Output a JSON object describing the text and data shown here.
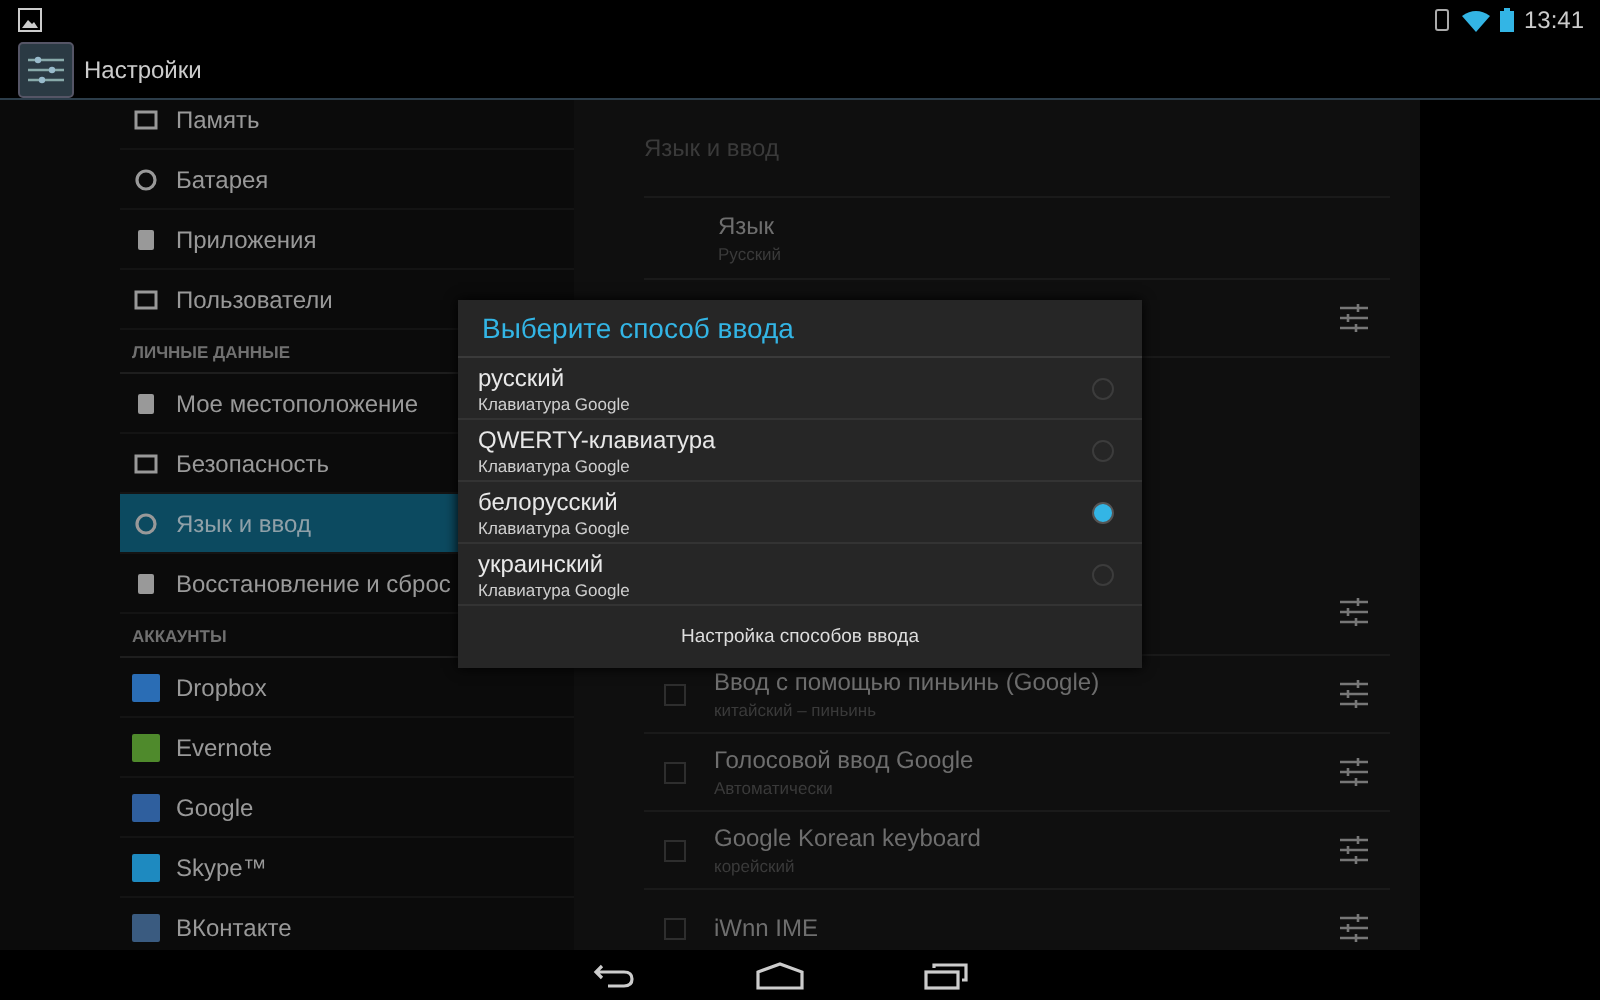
{
  "status_bar": {
    "time": "13:41"
  },
  "action_bar": {
    "title": "Настройки"
  },
  "sidebar": {
    "items": [
      {
        "kind": "item",
        "label": "Память",
        "selected": false
      },
      {
        "kind": "item",
        "label": "Батарея",
        "selected": false
      },
      {
        "kind": "item",
        "label": "Приложения",
        "selected": false
      },
      {
        "kind": "item",
        "label": "Пользователи",
        "selected": false
      },
      {
        "kind": "header",
        "label": "ЛИЧНЫЕ ДАННЫЕ"
      },
      {
        "kind": "item",
        "label": "Мое местоположение",
        "selected": false
      },
      {
        "kind": "item",
        "label": "Безопасность",
        "selected": false
      },
      {
        "kind": "item",
        "label": "Язык и ввод",
        "selected": true
      },
      {
        "kind": "item",
        "label": "Восстановление и сброс",
        "selected": false
      },
      {
        "kind": "header",
        "label": "АККАУНТЫ"
      },
      {
        "kind": "account",
        "label": "Dropbox",
        "selected": false,
        "color": "#2a6db5"
      },
      {
        "kind": "account",
        "label": "Evernote",
        "selected": false,
        "color": "#4f8a2c"
      },
      {
        "kind": "account",
        "label": "Google",
        "selected": false,
        "color": "#2f5f9e"
      },
      {
        "kind": "account",
        "label": "Skype™",
        "selected": false,
        "color": "#1e8ac0"
      },
      {
        "kind": "account",
        "label": "ВКонтакте",
        "selected": false,
        "color": "#3a5b80"
      }
    ]
  },
  "panel": {
    "title": "Язык и ввод",
    "language": {
      "label": "Язык",
      "value": "Русский"
    },
    "input_methods": [
      {
        "kind": "covered"
      },
      {
        "kind": "covered"
      },
      {
        "kind": "ime",
        "label": "Ввод с помощью пиньинь (Google)",
        "sub": "китайский – пиньинь",
        "checked": false
      },
      {
        "kind": "ime",
        "label": "Голосовой ввод Google",
        "sub": "Автоматически",
        "checked": false
      },
      {
        "kind": "ime",
        "label": "Google Korean keyboard",
        "sub": "корейский",
        "checked": false
      },
      {
        "kind": "ime",
        "label": "iWnn IME",
        "checked": false
      }
    ]
  },
  "dialog": {
    "title": "Выберите способ ввода",
    "options": [
      {
        "label": "русский",
        "sub": "Клавиатура Google",
        "selected": false
      },
      {
        "label": "QWERTY-клавиатура",
        "sub": "Клавиатура Google",
        "selected": false
      },
      {
        "label": "белорусский",
        "sub": "Клавиатура Google",
        "selected": true
      },
      {
        "label": "украинский",
        "sub": "Клавиатура Google",
        "selected": false
      }
    ],
    "button": "Настройка способов ввода"
  }
}
